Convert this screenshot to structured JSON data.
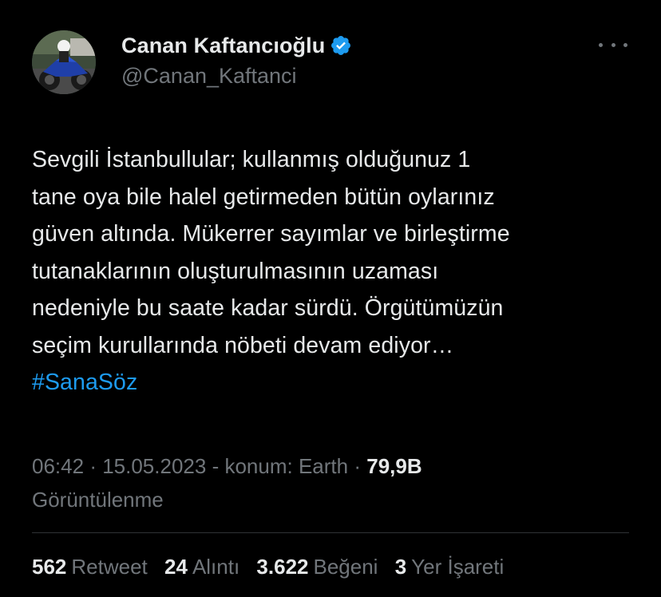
{
  "author": {
    "display_name": "Canan Kaftancıoğlu",
    "handle": "@Canan_Kaftanci",
    "verified_icon": "verified-badge-icon",
    "verified_color": "#1d9bf0"
  },
  "tweet": {
    "lines": [
      "Sevgili İstanbullular; kullanmış olduğunuz 1",
      "tane oya bile halel getirmeden bütün oylarınız",
      "güven altında. Mükerrer sayımlar ve birleştirme",
      "tutanaklarının oluşturulmasının uzaması",
      "nedeniyle bu saate kadar sürdü. Örgütümüzün",
      "seçim kurullarında nöbeti devam ediyor…"
    ],
    "hashtag": "#SanaSöz",
    "hashtag_color": "#1d9bf0"
  },
  "meta": {
    "time": "06:42",
    "date": "15.05.2023",
    "location": "konum: Earth",
    "views": "79,9B",
    "views_label": "Görüntülenme"
  },
  "stats": {
    "retweets": {
      "count": "562",
      "label": "Retweet"
    },
    "quotes": {
      "count": "24",
      "label": "Alıntı"
    },
    "likes": {
      "count": "3.622",
      "label": "Beğeni"
    },
    "bookmarks": {
      "count": "3",
      "label": "Yer İşareti"
    }
  },
  "colors": {
    "background": "#000000",
    "text_primary": "#e7e9ea",
    "text_secondary": "#71767b",
    "divider": "#2f3336"
  }
}
